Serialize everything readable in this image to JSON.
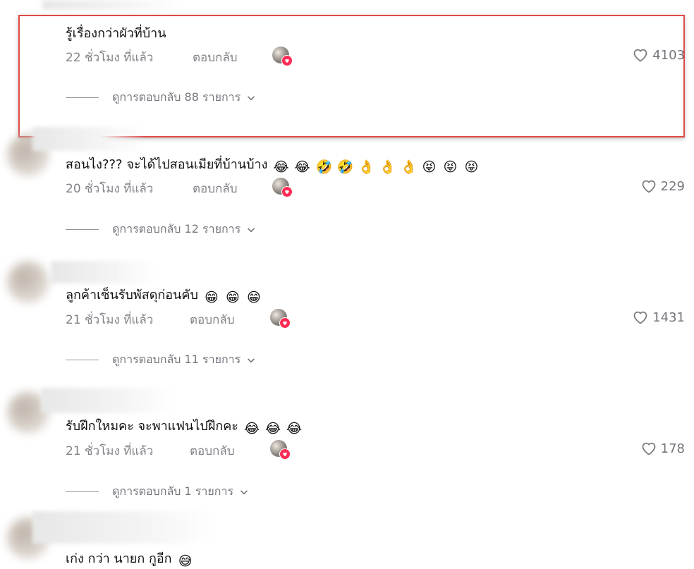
{
  "colors": {
    "accent": "#fe2c55",
    "highlight": "#e04848",
    "muted_text": "#8a8b91"
  },
  "comments": [
    {
      "text": "รู้เรื่องกว่าผัวที่บ้าน",
      "emojis": [],
      "time": "22 ชั่วโมง ที่แล้ว",
      "reply": "ตอบกลับ",
      "likes": "4103",
      "view_replies": "ดูการตอบกลับ 88 รายการ"
    },
    {
      "text": "สอนไง??? จะได้ไปสอนเมียที่บ้านบ้าง",
      "emojis": [
        "😂",
        "😂",
        "🤣",
        "🤣",
        "👌",
        "👌",
        "👌",
        "😝",
        "😝",
        "😝"
      ],
      "time": "20 ชั่วโมง ที่แล้ว",
      "reply": "ตอบกลับ",
      "likes": "229",
      "view_replies": "ดูการตอบกลับ 12 รายการ"
    },
    {
      "text": "ลูกค้าเซ็นรับพัสดุก่อนคับ",
      "emojis": [
        "😁",
        "😁",
        "😁"
      ],
      "time": "21 ชั่วโมง ที่แล้ว",
      "reply": "ตอบกลับ",
      "likes": "1431",
      "view_replies": "ดูการตอบกลับ 11 รายการ"
    },
    {
      "text": "รับฝึกใหมคะ จะพาแฟนไปฝึกคะ",
      "emojis": [
        "😂",
        "😂",
        "😂"
      ],
      "time": "21 ชั่วโมง ที่แล้ว",
      "reply": "ตอบกลับ",
      "likes": "178",
      "view_replies": "ดูการตอบกลับ 1 รายการ"
    },
    {
      "text": "เก่ง กว่า นายก กูอีก",
      "emojis": [
        "😅"
      ]
    }
  ],
  "icons": {
    "heart": "heart-outline-icon",
    "chevron": "chevron-down-icon",
    "creator_like": "creator-liked-badge"
  }
}
